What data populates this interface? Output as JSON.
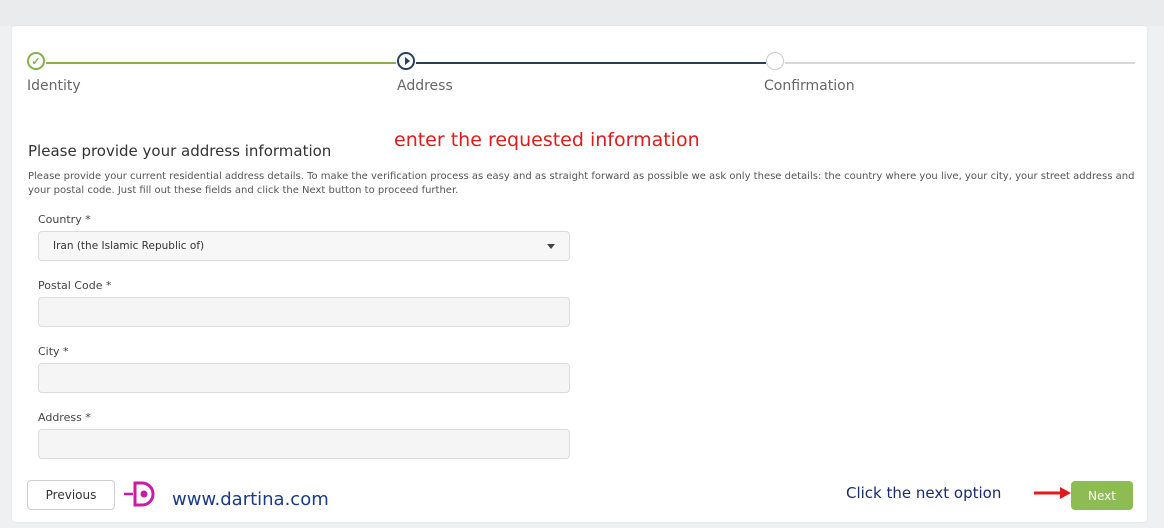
{
  "stepper": {
    "steps": [
      {
        "label": "Identity",
        "state": "complete"
      },
      {
        "label": "Address",
        "state": "current"
      },
      {
        "label": "Confirmation",
        "state": "pending"
      }
    ]
  },
  "annotations": {
    "instruction": "enter the requested information",
    "next_hint": "Click the next option",
    "watermark": "www.dartina.com"
  },
  "form": {
    "title": "Please provide your address information",
    "description": "Please provide your current residential address details. To make the verification process as easy and as straight forward as possible we ask only these details: the country where you live, your city, your street address and your postal code. Just fill out these fields and click the Next button to proceed further.",
    "country": {
      "label": "Country *",
      "value": "Iran (the Islamic Republic of)"
    },
    "postal_code": {
      "label": "Postal Code *",
      "value": ""
    },
    "city": {
      "label": "City *",
      "value": ""
    },
    "address": {
      "label": "Address *",
      "value": ""
    }
  },
  "buttons": {
    "previous": "Previous",
    "next": "Next"
  },
  "colors": {
    "complete": "#86b04a",
    "current": "#2a3f5f",
    "pending": "#d6d8da",
    "next_button": "#8cbc52",
    "annotation_red": "#e11b1b"
  }
}
